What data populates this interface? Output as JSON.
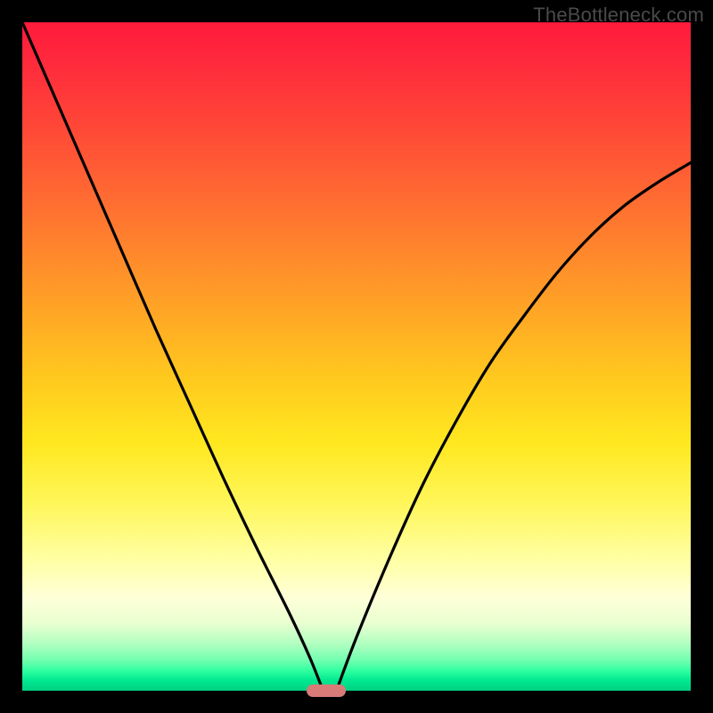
{
  "watermark": "TheBottleneck.com",
  "colors": {
    "frame": "#000000",
    "curve": "#000000",
    "marker": "#d87a78",
    "gradient_stops": [
      "#ff1a3c",
      "#ff2a3c",
      "#ff4238",
      "#ff6a32",
      "#ff9a28",
      "#ffc81e",
      "#ffe820",
      "#fff65a",
      "#ffffa0",
      "#ffffd8",
      "#e8ffd0",
      "#b0ffc0",
      "#70ffb0",
      "#30ffa0",
      "#00e890",
      "#00d080"
    ]
  },
  "chart_data": {
    "type": "line",
    "title": "",
    "xlabel": "",
    "ylabel": "",
    "xlim": [
      0,
      1
    ],
    "ylim": [
      0,
      1
    ],
    "grid": false,
    "legend": false,
    "notes": "Two curves forming a V/cusp meeting at the bottom near x≈0.45. Background is a vertical red→green gradient. A small rounded salmon marker sits at the cusp on the x-axis.",
    "series": [
      {
        "name": "left-curve",
        "x": [
          0.0,
          0.05,
          0.1,
          0.15,
          0.2,
          0.25,
          0.3,
          0.35,
          0.4,
          0.43,
          0.45
        ],
        "y": [
          1.0,
          0.885,
          0.77,
          0.655,
          0.54,
          0.43,
          0.32,
          0.215,
          0.115,
          0.05,
          0.0
        ]
      },
      {
        "name": "right-curve",
        "x": [
          0.47,
          0.5,
          0.55,
          0.6,
          0.65,
          0.7,
          0.75,
          0.8,
          0.85,
          0.9,
          0.95,
          1.0
        ],
        "y": [
          0.0,
          0.08,
          0.2,
          0.31,
          0.405,
          0.49,
          0.56,
          0.625,
          0.68,
          0.725,
          0.76,
          0.79
        ]
      }
    ],
    "marker": {
      "x": 0.455,
      "y": 0.0
    }
  }
}
